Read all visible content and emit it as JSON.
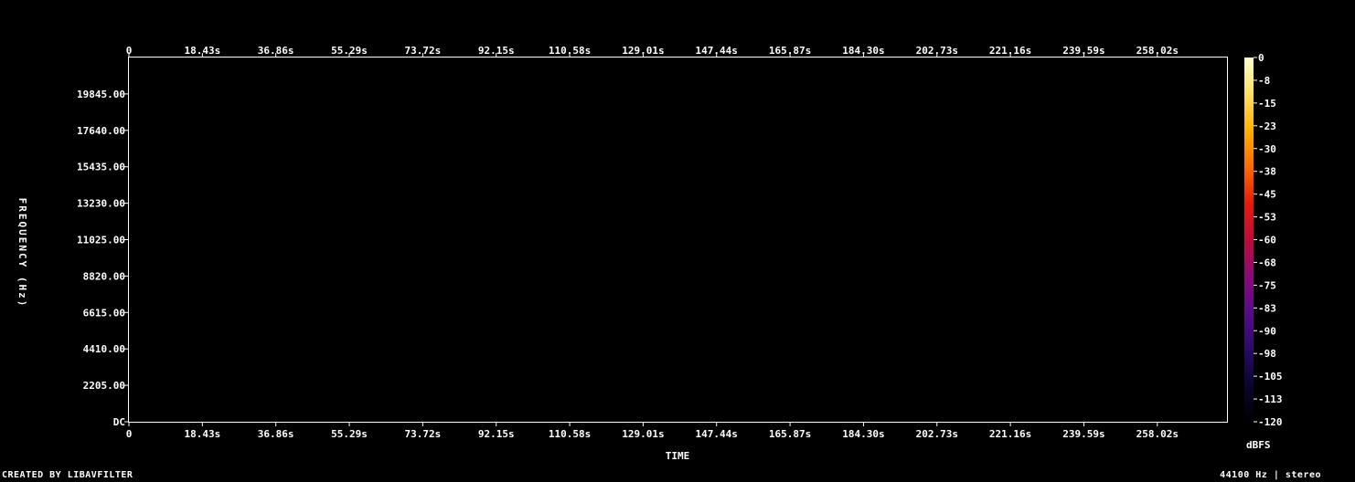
{
  "chart_data": {
    "type": "heatmap",
    "subtype": "spectrogram",
    "xlabel": "TIME",
    "ylabel": "FREQUENCY (Hz)",
    "x_ticks": [
      "0",
      "18.43s",
      "36.86s",
      "55.29s",
      "73.72s",
      "92.15s",
      "110.58s",
      "129.01s",
      "147.44s",
      "165.87s",
      "184.30s",
      "202.73s",
      "221.16s",
      "239.59s",
      "258.02s"
    ],
    "x_tick_values": [
      0,
      18.43,
      36.86,
      55.29,
      73.72,
      92.15,
      110.58,
      129.01,
      147.44,
      165.87,
      184.3,
      202.73,
      221.16,
      239.59,
      258.02
    ],
    "x_range": [
      0,
      275.5
    ],
    "y_ticks": [
      "DC",
      "2205.00",
      "4410.00",
      "6615.00",
      "8820.00",
      "11025.00",
      "13230.00",
      "15435.00",
      "17640.00",
      "19845.00"
    ],
    "y_tick_values": [
      0,
      2205,
      4410,
      6615,
      8820,
      11025,
      13230,
      15435,
      17640,
      19845
    ],
    "y_range": [
      0,
      22050
    ],
    "colorbar": {
      "label": "dBFS",
      "ticks": [
        "0",
        "-8",
        "-15",
        "-23",
        "-30",
        "-38",
        "-45",
        "-53",
        "-60",
        "-68",
        "-75",
        "-83",
        "-90",
        "-98",
        "-105",
        "-113",
        "-120"
      ],
      "range": [
        -120,
        0
      ],
      "colormap": [
        "#000000",
        "#0a0530",
        "#2a0a6a",
        "#5a0a8a",
        "#8a0a7a",
        "#c00a3a",
        "#e81a0a",
        "#ff6a00",
        "#ffb000",
        "#ffe060",
        "#ffffd0"
      ]
    }
  },
  "footer": {
    "left": "CREATED BY LIBAVFILTER",
    "right": "44100 Hz | stereo"
  }
}
